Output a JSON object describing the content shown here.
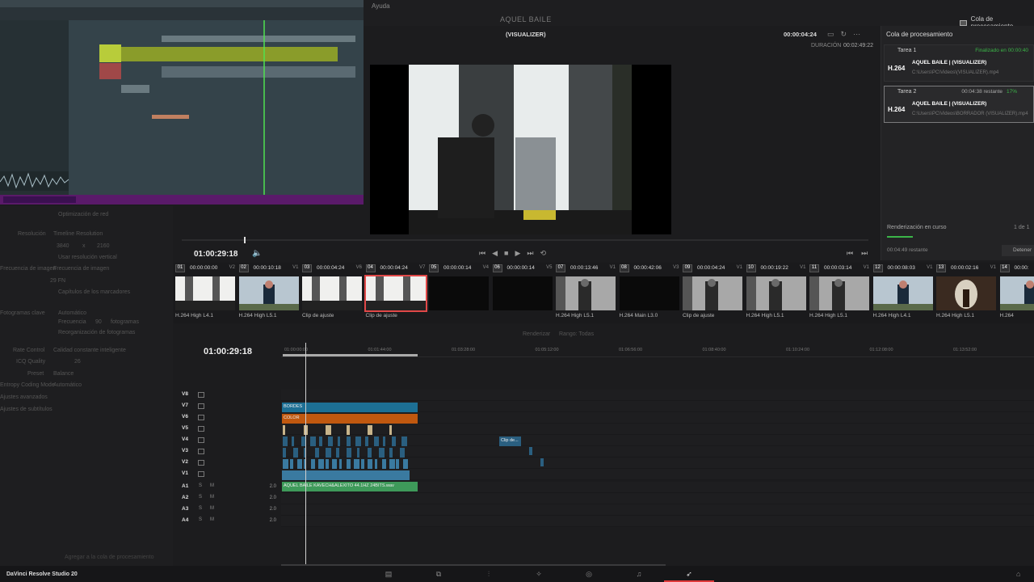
{
  "topbar": {
    "menu_ayuda": "Ayuda",
    "project_title": "AQUEL BAILE",
    "render_queue_label": "Cola de procesamiento"
  },
  "viewer": {
    "clip_name": "(VISUALIZER)",
    "timecode": "00:00:04:24",
    "duration_label": "DURACIÓN",
    "duration_value": "00:02:49:22",
    "current_timecode": "01:00:29:18"
  },
  "render_queue": {
    "title": "Cola de procesamiento",
    "jobs": [
      {
        "label": "Tarea 1",
        "status": "Finalizado en 00:00:40",
        "codec": "H.264",
        "name": "AQUEL BAILE | (VISUALIZER)",
        "path": "C:\\Users\\PC\\Videos\\(VISUALIZER).mp4"
      },
      {
        "label": "Tarea 2",
        "status": "00:04:38 restante",
        "progress": "17%",
        "codec": "H.264",
        "name": "AQUEL BAILE | (VISUALIZER)",
        "path": "C:\\Users\\PC\\Videos\\BORRADOR (VISUALIZER).mp4"
      }
    ],
    "rendering_label": "Renderización en curso",
    "count": "1 de 1",
    "progress_fraction": 0.17,
    "remaining": "00:04:49 restante",
    "stop_label": "Detener"
  },
  "clips": [
    {
      "num": "01",
      "tc": "00:00:00:00",
      "track": "V2",
      "caption": "H.264 High L4.1",
      "thumb": "light",
      "selected": false
    },
    {
      "num": "02",
      "tc": "00:00:10:18",
      "track": "V1",
      "caption": "H.264 High L5.1",
      "thumb": "person",
      "selected": false
    },
    {
      "num": "03",
      "tc": "00:00:04:24",
      "track": "V6",
      "caption": "Clip de ajuste",
      "thumb": "light",
      "selected": false
    },
    {
      "num": "04",
      "tc": "00:00:04:24",
      "track": "V7",
      "caption": "Clip de ajuste",
      "thumb": "light",
      "selected": true
    },
    {
      "num": "05",
      "tc": "00:00:00:14",
      "track": "V4",
      "caption": "",
      "thumb": "dark",
      "selected": false
    },
    {
      "num": "06",
      "tc": "00:00:00:14",
      "track": "V5",
      "caption": "",
      "thumb": "dark",
      "selected": false
    },
    {
      "num": "07",
      "tc": "00:00:13:46",
      "track": "V1",
      "caption": "H.264 High L5.1",
      "thumb": "bw",
      "selected": false
    },
    {
      "num": "08",
      "tc": "00:00:42:06",
      "track": "V3",
      "caption": "H.264 Main L3.0",
      "thumb": "dark",
      "selected": false
    },
    {
      "num": "09",
      "tc": "00:00:04:24",
      "track": "V1",
      "caption": "Clip de ajuste",
      "thumb": "bw",
      "selected": false
    },
    {
      "num": "10",
      "tc": "00:00:19:22",
      "track": "V1",
      "caption": "H.264 High L5.1",
      "thumb": "bw",
      "selected": false
    },
    {
      "num": "11",
      "tc": "00:00:03:14",
      "track": "V1",
      "caption": "H.264 High L5.1",
      "thumb": "bw",
      "selected": false
    },
    {
      "num": "12",
      "tc": "00:00:08:03",
      "track": "V1",
      "caption": "H.264 High L4.1",
      "thumb": "person",
      "selected": false
    },
    {
      "num": "13",
      "tc": "00:00:02:16",
      "track": "V1",
      "caption": "H.264 High L5.1",
      "thumb": "arch",
      "selected": false
    },
    {
      "num": "14",
      "tc": "00:00:",
      "track": "",
      "caption": "H.264",
      "thumb": "person",
      "selected": false
    }
  ],
  "left_panel": {
    "optimizacion": "Optimización de red",
    "resolucion_label": "Resolución",
    "resolucion": "Timeline Resolution",
    "width": "3840",
    "x": "x",
    "height": "2160",
    "usar_vertical": "Usar resolución vertical",
    "frecuencia_label": "Frecuencia de imagen",
    "frecuencia": "Frecuencia de imagen",
    "fps": "29 FN",
    "capitulos": "Capítulos de los marcadores",
    "fotogramas_label": "Fotogramas clave",
    "automatico": "Automático",
    "frecuencia_kf": "Frecuencia",
    "frecuencia_kf_val": "90",
    "frecuencia_kf_unit": "fotogramas",
    "reorg": "Reorganización de fotogramas",
    "rate_label": "Rate Control",
    "rate": "Calidad constante inteligente",
    "icq_label": "ICQ Quality",
    "icq": "26",
    "preset_label": "Preset",
    "preset": "Balance",
    "entropy_label": "Entropy Coding Mode",
    "entropy": "Automático",
    "ajustes_av": "Ajustes avanzados",
    "ajustes_sub": "Ajustes de subtítulos",
    "add_queue": "Agregar a la cola de procesamiento"
  },
  "timeline": {
    "timecode": "01:00:29:18",
    "render_label": "Renderizar",
    "range": "Rango: Todas",
    "ruler": [
      "01:00:00:00",
      "01:01:44:00",
      "01:03:28:00",
      "01:05:12:00",
      "01:06:56:00",
      "01:08:40:00",
      "01:10:24:00",
      "01:12:08:00",
      "01:13:52:00"
    ],
    "video_tracks": [
      "V8",
      "V7",
      "V6",
      "V5",
      "V4",
      "V3",
      "V2",
      "V1"
    ],
    "audio_tracks": [
      {
        "name": "A1",
        "vol": "2.0"
      },
      {
        "name": "A2",
        "vol": "2.0"
      },
      {
        "name": "A3",
        "vol": "2.0"
      },
      {
        "name": "A4",
        "vol": "2.0"
      }
    ],
    "clip_bordes": "BORDES",
    "clip_color": "COLOR",
    "clip_small": "Clip de...",
    "audio_clip": "AQUEL BAILE KAVECH&ALEXITO 44.1HZ 24BITS.wav",
    "s_label": "S",
    "m_label": "M"
  },
  "bottombar": {
    "app_name": "DaVinci Resolve Studio 20",
    "pages": [
      "media",
      "cut",
      "edit",
      "fusion",
      "color",
      "fairlight",
      "deliver"
    ]
  },
  "colors": {
    "accent": "#e0393a",
    "bordes": "#1d6f94",
    "color_clip": "#c0580f",
    "audio": "#3e9a5a",
    "render_green": "#3bb548"
  }
}
